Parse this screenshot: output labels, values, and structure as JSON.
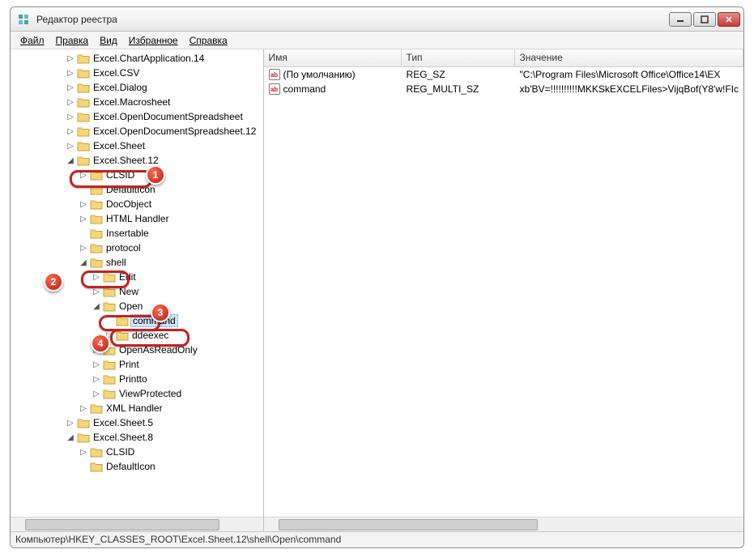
{
  "window": {
    "title": "Редактор реестра"
  },
  "menu": {
    "file": "Файл",
    "edit": "Правка",
    "view": "Вид",
    "favorites": "Избранное",
    "help": "Справка"
  },
  "columns": {
    "name": "Имя",
    "type": "Тип",
    "value": "Значение"
  },
  "tree": [
    {
      "indent": 3,
      "exp": "▷",
      "label": "Excel.ChartApplication.14"
    },
    {
      "indent": 3,
      "exp": "▷",
      "label": "Excel.CSV"
    },
    {
      "indent": 3,
      "exp": "▷",
      "label": "Excel.Dialog"
    },
    {
      "indent": 3,
      "exp": "▷",
      "label": "Excel.Macrosheet"
    },
    {
      "indent": 3,
      "exp": "▷",
      "label": "Excel.OpenDocumentSpreadsheet"
    },
    {
      "indent": 3,
      "exp": "▷",
      "label": "Excel.OpenDocumentSpreadsheet.12"
    },
    {
      "indent": 3,
      "exp": "▷",
      "label": "Excel.Sheet"
    },
    {
      "indent": 3,
      "exp": "◢",
      "label": "Excel.Sheet.12"
    },
    {
      "indent": 4,
      "exp": "▷",
      "label": "CLSID"
    },
    {
      "indent": 4,
      "exp": "",
      "label": "DefaultIcon"
    },
    {
      "indent": 4,
      "exp": "▷",
      "label": "DocObject"
    },
    {
      "indent": 4,
      "exp": "▷",
      "label": "HTML Handler"
    },
    {
      "indent": 4,
      "exp": "",
      "label": "Insertable"
    },
    {
      "indent": 4,
      "exp": "▷",
      "label": "protocol"
    },
    {
      "indent": 4,
      "exp": "◢",
      "label": "shell"
    },
    {
      "indent": 5,
      "exp": "▷",
      "label": "Edit"
    },
    {
      "indent": 5,
      "exp": "▷",
      "label": "New"
    },
    {
      "indent": 5,
      "exp": "◢",
      "label": "Open"
    },
    {
      "indent": 6,
      "exp": "",
      "label": "command",
      "selected": true
    },
    {
      "indent": 6,
      "exp": "▷",
      "label": "ddeexec"
    },
    {
      "indent": 5,
      "exp": "▷",
      "label": "OpenAsReadOnly"
    },
    {
      "indent": 5,
      "exp": "▷",
      "label": "Print"
    },
    {
      "indent": 5,
      "exp": "▷",
      "label": "Printto"
    },
    {
      "indent": 5,
      "exp": "▷",
      "label": "ViewProtected"
    },
    {
      "indent": 4,
      "exp": "▷",
      "label": "XML Handler"
    },
    {
      "indent": 3,
      "exp": "▷",
      "label": "Excel.Sheet.5"
    },
    {
      "indent": 3,
      "exp": "◢",
      "label": "Excel.Sheet.8"
    },
    {
      "indent": 4,
      "exp": "▷",
      "label": "CLSID"
    },
    {
      "indent": 4,
      "exp": "",
      "label": "DefaultIcon"
    }
  ],
  "values": [
    {
      "name": "(По умолчанию)",
      "type": "REG_SZ",
      "value": "\"C:\\Program Files\\Microsoft Office\\Office14\\EX"
    },
    {
      "name": "command",
      "type": "REG_MULTI_SZ",
      "value": "xb'BV=!!!!!!!!!!MKKSkEXCELFiles>VijqBof(Y8'w!FIc"
    }
  ],
  "statusbar": "Компьютер\\HKEY_CLASSES_ROOT\\Excel.Sheet.12\\shell\\Open\\command",
  "icon_label": "ab",
  "callouts": {
    "1": "1",
    "2": "2",
    "3": "3",
    "4": "4"
  }
}
